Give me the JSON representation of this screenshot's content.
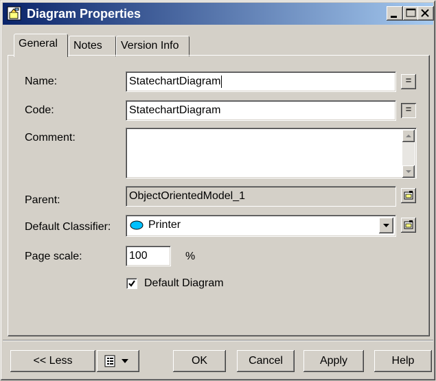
{
  "window": {
    "title": "Diagram Properties"
  },
  "tabs": [
    {
      "label": "General",
      "active": true
    },
    {
      "label": "Notes",
      "active": false
    },
    {
      "label": "Version Info",
      "active": false
    }
  ],
  "form": {
    "name": {
      "label": "Name:",
      "value": "StatechartDiagram"
    },
    "code": {
      "label": "Code:",
      "value": "StatechartDiagram"
    },
    "comment": {
      "label": "Comment:",
      "value": ""
    },
    "parent": {
      "label": "Parent:",
      "value": "ObjectOrientedModel_1"
    },
    "default_classifier": {
      "label": "Default Classifier:",
      "value": "Printer"
    },
    "page_scale": {
      "label": "Page scale:",
      "value": "100",
      "unit": "%"
    },
    "default_diagram": {
      "label": "Default Diagram",
      "checked": true
    },
    "equals_label": "="
  },
  "buttons": {
    "less": "<< Less",
    "ok": "OK",
    "cancel": "Cancel",
    "apply": "Apply",
    "help": "Help"
  },
  "icons": {
    "title": "properties-icon",
    "classifier": "ellipse-class-icon",
    "properties": "properties-icon",
    "list_menu": "list-icon"
  },
  "colors": {
    "titlebar_start": "#0a246a",
    "titlebar_end": "#a6caf0",
    "face": "#d4d0c8",
    "classifier_fill": "#00c0ff"
  }
}
